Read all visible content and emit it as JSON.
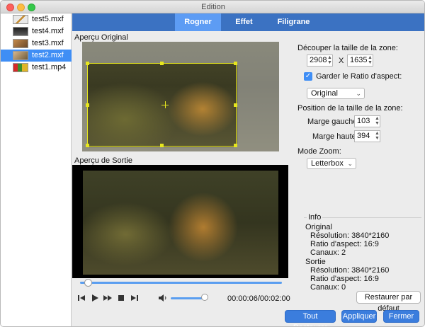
{
  "window": {
    "title": "Edition"
  },
  "files": [
    {
      "name": "test5.mxf",
      "selected": false
    },
    {
      "name": "test4.mxf",
      "selected": false
    },
    {
      "name": "test3.mxf",
      "selected": false
    },
    {
      "name": "test2.mxf",
      "selected": true
    },
    {
      "name": "test1.mp4",
      "selected": false
    }
  ],
  "tabs": [
    {
      "label": "Rogner",
      "active": true
    },
    {
      "label": "Effet",
      "active": false
    },
    {
      "label": "Filigrane",
      "active": false
    }
  ],
  "preview": {
    "original_label": "Aperçu Original",
    "output_label": "Aperçu de Sortie"
  },
  "playback": {
    "timecode": "00:00:06/00:02:00",
    "progress": 0.03,
    "volume": 0.9,
    "icons": [
      "skip-back-icon",
      "play-icon",
      "fast-forward-icon",
      "stop-icon",
      "skip-forward-icon",
      "volume-icon"
    ]
  },
  "crop": {
    "size_label": "Découper la taille de la zone:",
    "width": "2908",
    "times": "X",
    "height": "1635",
    "keep_ratio_label": "Garder le Ratio d'aspect:",
    "keep_ratio_checked": true,
    "ratio_value": "Original",
    "position_label": "Position de la taille de la zone:",
    "left_margin_label": "Marge gauche:",
    "left_margin": "103",
    "top_margin_label": "Marge haute:",
    "top_margin": "394",
    "zoom_label": "Mode Zoom:",
    "zoom_value": "Letterbox"
  },
  "info": {
    "title": "Info",
    "original_heading": "Original",
    "original_resolution": "Résolution: 3840*2160",
    "original_ratio": "Ratio d'aspect: 16:9",
    "original_channels": "Canaux: 2",
    "output_heading": "Sortie",
    "output_resolution": "Résolution: 3840*2160",
    "output_ratio": "Ratio d'aspect: 16:9",
    "output_channels": "Canaux: 0"
  },
  "buttons": {
    "reset_default": "Restaurer par défaut",
    "restore_all": "Tout Restaurer",
    "apply": "Appliquer",
    "close": "Fermer"
  },
  "colors": {
    "tab_bar": "#3b72c2",
    "tab_active": "#5d9cf4",
    "selection": "#3f8ef5",
    "crop_frame": "#e6e61e"
  }
}
